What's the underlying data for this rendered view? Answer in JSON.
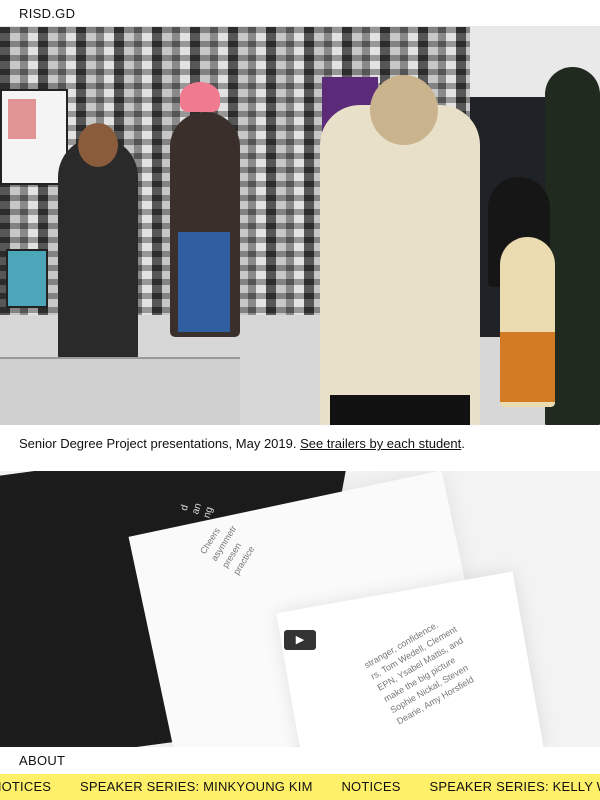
{
  "header": {
    "site_title": "RISD.GD"
  },
  "gallery1": {
    "caption_text": "Senior Degree Project presentations, May 2019. ",
    "caption_link": "See trailers by each student",
    "caption_suffix": ".",
    "slide_count": 4,
    "active_slide": 1
  },
  "gallery2": {
    "spine_text": "d\nan\nng",
    "page_text_1": "Cheers\nasymmetr\npresen\npractice",
    "page_text_2": "stranger, confidence.\nrs, Tom Wedell, Clement\nEPN, Ysabel Mattis, and\nmake the big picture\nSophie Nickal, Steven\nDearie, Amy Horsfield"
  },
  "footer": {
    "about_label": "ABOUT",
    "ticker": [
      "NOTICES",
      "SPEAKER SERIES: MINKYOUNG KIM",
      "NOTICES",
      "SPEAKER SERIES: KELLY WALTERS"
    ]
  },
  "colors": {
    "ticker_bg": "#fff06a",
    "text": "#111111"
  }
}
